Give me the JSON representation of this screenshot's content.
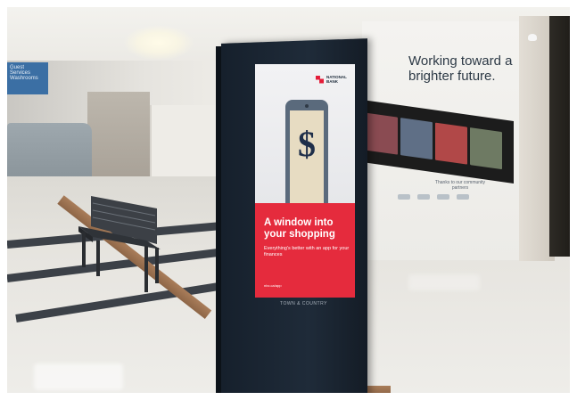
{
  "scene": {
    "description_colors": {
      "screen_red": "#e52b3d",
      "kiosk_navy": "#1f2b39",
      "phone_gray": "#5a6a7c"
    }
  },
  "kiosk": {
    "bank_name": "NATIONAL BANK",
    "headline": "A window into your shopping",
    "subline": "Everything's better with an app for your finances",
    "small_print": "nbc.ca/app",
    "footer_logo": "TOWN & COUNTRY",
    "dollar_symbol": "$"
  },
  "mural": {
    "title": "Working toward a brighter future.",
    "note": "Thanks to our community partners"
  },
  "left_sign": {
    "text": "Guest Services Washrooms"
  }
}
